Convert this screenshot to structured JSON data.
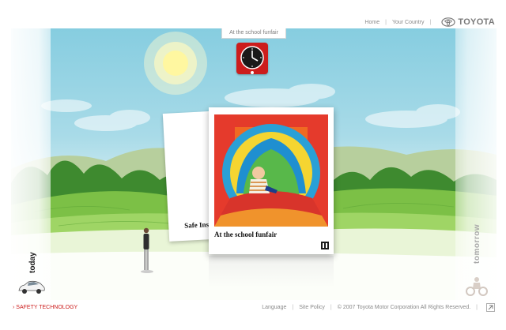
{
  "nav": {
    "home": "Home",
    "sep1": "|",
    "your_country": "Your Country",
    "sep2": "|",
    "brand": "TOYOTA"
  },
  "timeline": {
    "today_label": "today",
    "tomorrow_label": "tomorrow",
    "current_scene": "At the school funfair"
  },
  "cards": {
    "back_title": "Safe Ins",
    "front_title": "At the school funfair"
  },
  "footer": {
    "arrow": "›",
    "safety_label": "SAFETY TECHNOLOGY",
    "language": "Language",
    "sep1": "|",
    "site_policy": "Site Policy",
    "sep2": "|",
    "copyright": "© 2007 Toyota Motor Corporation All Rights Reserved.",
    "sep3": "|"
  },
  "icons": {
    "logo": "toyota-logo-icon",
    "clock": "clock-icon",
    "pause": "pause-icon",
    "car": "car-icon",
    "quad": "quad-bike-icon",
    "corner": "corner-icon"
  },
  "colors": {
    "accent_red": "#cc1d1d",
    "sky": "#86cde0",
    "grass": "#7cc046",
    "trees": "#3e8a2f"
  }
}
